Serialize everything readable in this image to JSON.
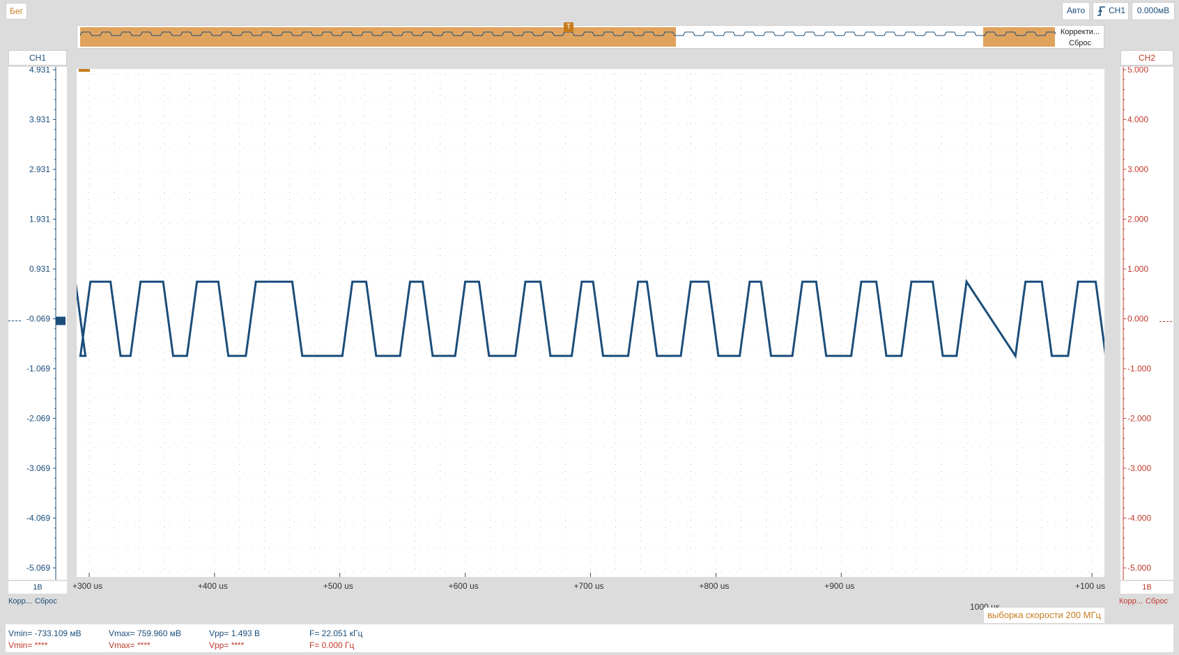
{
  "toolbar": {
    "run_label": "Бег",
    "trigger_mode": "Авто",
    "trigger_source": "CH1",
    "trigger_level": "0.000мВ"
  },
  "overview": {
    "btn_correct": "Корректи...",
    "btn_reset": "Сброс",
    "trigger_marker": "T"
  },
  "channels": {
    "ch1": {
      "label": "CH1",
      "scale": "1В",
      "btn_correct": "Корр...",
      "btn_reset": "Сброс",
      "color": "#1a4d7a"
    },
    "ch2": {
      "label": "CH2",
      "scale": "1В",
      "btn_correct": "Корр...",
      "btn_reset": "Сброс",
      "color": "#c0392b"
    }
  },
  "sample_rate": "выборка скорости 200 МГц",
  "measurements": {
    "ch1": {
      "vmin": "Vmin= -733.109 мВ",
      "vmax": "Vmax= 759.960 мВ",
      "vpp": "Vpp= 1.493 В",
      "freq": "F= 22.051 кГц"
    },
    "ch2": {
      "vmin": "Vmin= ****",
      "vmax": "Vmax= ****",
      "vpp": "Vpp= ****",
      "freq": "F= 0.000 Гц"
    }
  },
  "chart_data": {
    "type": "line",
    "ch1_axis": {
      "ticks": [
        "4.931",
        "3.931",
        "2.931",
        "1.931",
        "0.931",
        "-0.069",
        "-1.069",
        "-2.069",
        "-3.069",
        "-4.069",
        "-5.069"
      ],
      "ylim": [
        -5.069,
        4.931
      ]
    },
    "ch2_axis": {
      "ticks": [
        "5.000",
        "4.000",
        "3.000",
        "2.000",
        "1.000",
        "0.000",
        "-1.000",
        "-2.000",
        "-3.000",
        "-4.000",
        "-5.000"
      ],
      "ylim": [
        -5,
        5
      ]
    },
    "x_ticks": [
      "+300 us",
      "+400 us",
      "+500 us",
      "+600 us",
      "+700 us",
      "+800 us",
      "+900 us",
      "+100 us"
    ],
    "x_offset_label": "1000 us",
    "xlim": [
      290,
      1110
    ],
    "series": [
      {
        "name": "CH1",
        "color": "#1a4d7a",
        "high": 0.76,
        "low": -0.73,
        "rise_us": [
          293,
          333,
          378,
          425,
          502,
          548,
          592,
          640,
          685,
          730,
          772,
          819,
          861,
          908,
          948,
          992,
          1039,
          1081
        ],
        "fall_us": [
          289,
          317,
          359,
          403,
          462,
          521,
          566,
          611,
          660,
          702,
          745,
          794,
          836,
          880,
          928,
          973,
          1060,
          1103
        ]
      }
    ]
  }
}
